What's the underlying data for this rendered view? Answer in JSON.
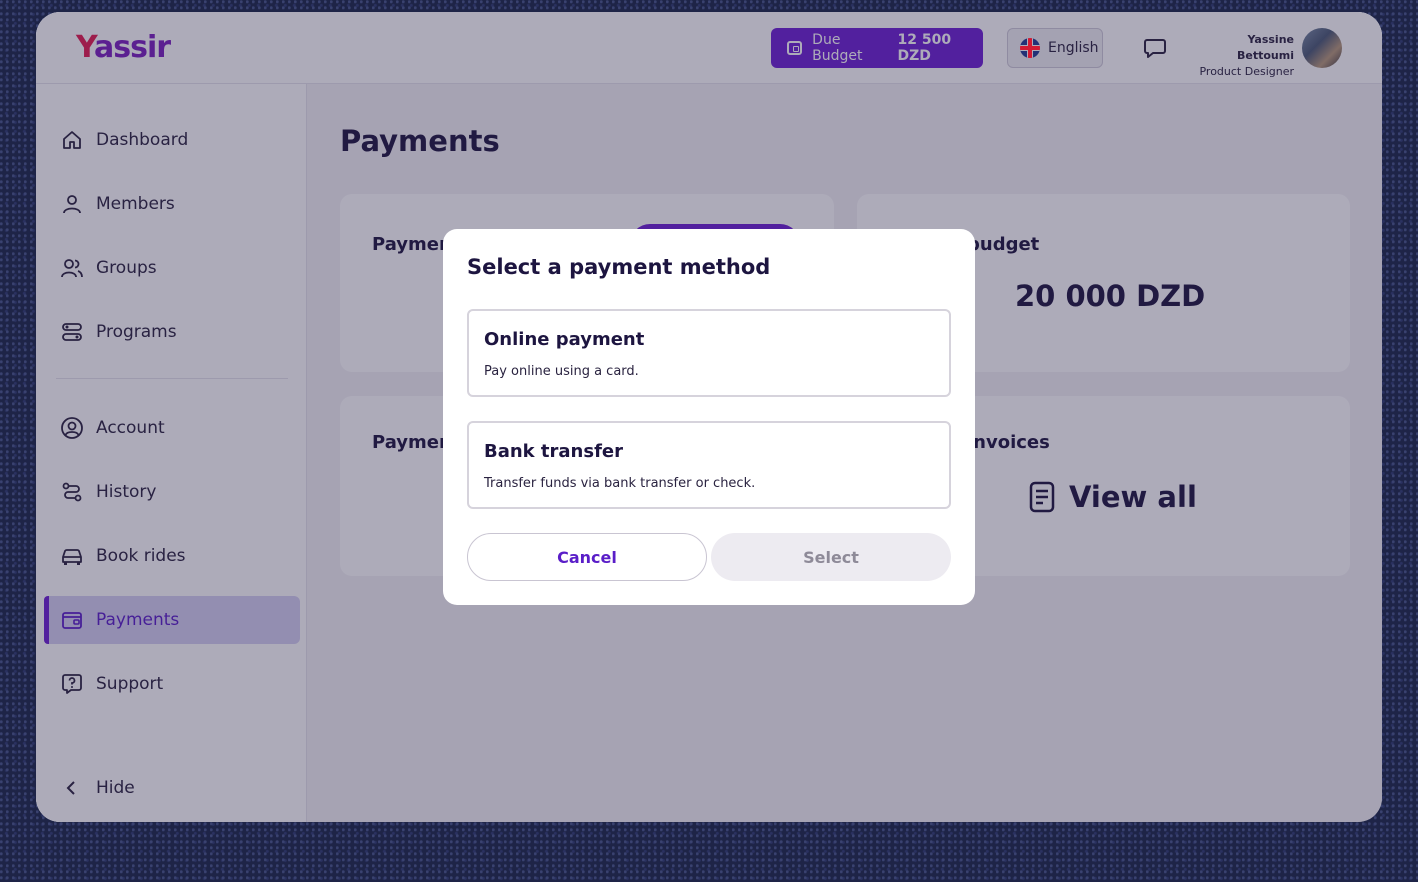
{
  "app": {
    "logo_text": "Yassir",
    "logo_first_letter": "Y",
    "logo_rest": "assir",
    "brand_colors": {
      "logo_red": "#e51b4f",
      "accent_purple": "#6c1fd4"
    }
  },
  "header": {
    "due_budget_label": "Due Budget",
    "due_budget_value": "12 500 DZD",
    "language": "English",
    "user_name": "Yassine Bettoumi",
    "user_role": "Product Designer"
  },
  "sidebar": {
    "items": [
      {
        "label": "Dashboard",
        "icon": "home-icon"
      },
      {
        "label": "Members",
        "icon": "user-icon"
      },
      {
        "label": "Groups",
        "icon": "users-icon"
      },
      {
        "label": "Programs",
        "icon": "programs-icon"
      },
      {
        "label": "Account",
        "icon": "account-icon"
      },
      {
        "label": "History",
        "icon": "history-icon"
      },
      {
        "label": "Book rides",
        "icon": "car-icon"
      },
      {
        "label": "Payments",
        "icon": "wallet-icon",
        "active": true
      },
      {
        "label": "Support",
        "icon": "help-icon"
      }
    ],
    "hide_label": "Hide"
  },
  "main": {
    "page_title": "Payments",
    "cards": {
      "top_left_title": "Paymen",
      "top_right_title": "budget",
      "top_right_value": "20 000 DZD",
      "bottom_left_title": "Paymen",
      "bottom_right_title": "invoices",
      "bottom_right_link": "View all"
    }
  },
  "modal": {
    "title": "Select a payment method",
    "options": [
      {
        "title": "Online payment",
        "description": "Pay online using a card."
      },
      {
        "title": "Bank transfer",
        "description": "Transfer funds via bank transfer or check."
      }
    ],
    "cancel_label": "Cancel",
    "select_label": "Select"
  }
}
